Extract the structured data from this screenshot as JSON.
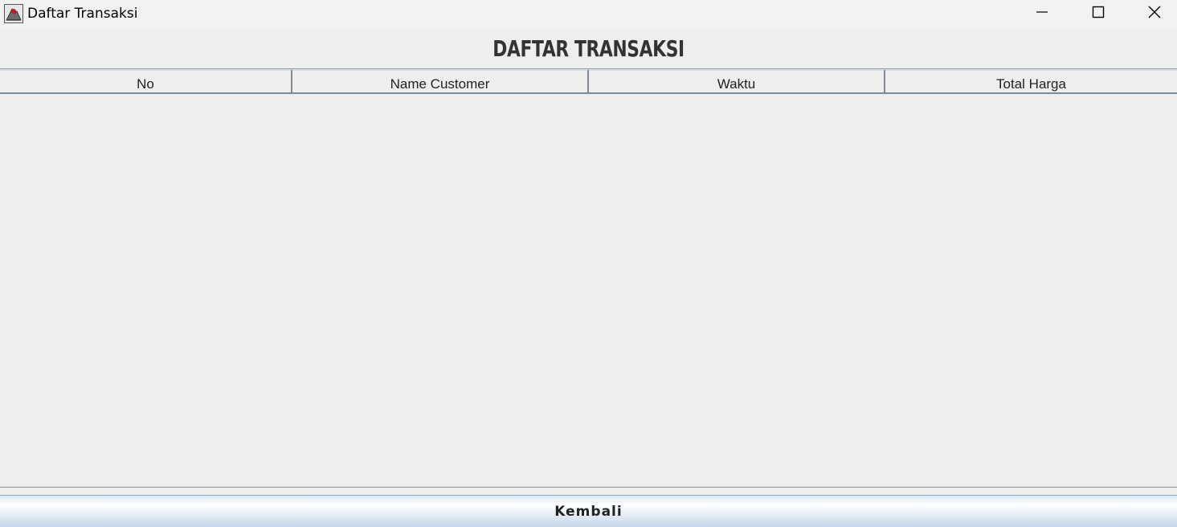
{
  "window": {
    "title": "Daftar Transaksi",
    "icons": {
      "app": "java-app-icon",
      "minimize": "minimize-icon",
      "maximize": "maximize-icon",
      "close": "close-icon"
    }
  },
  "heading": "DAFTAR TRANSAKSI",
  "table": {
    "columns": [
      "No",
      "Name Customer",
      "Waktu",
      "Total Harga"
    ],
    "rows": []
  },
  "button": {
    "back_label": "Kembali"
  },
  "colors": {
    "background": "#eeeeee",
    "heading_text": "#333333",
    "button_accent": "#c6d6ea"
  }
}
